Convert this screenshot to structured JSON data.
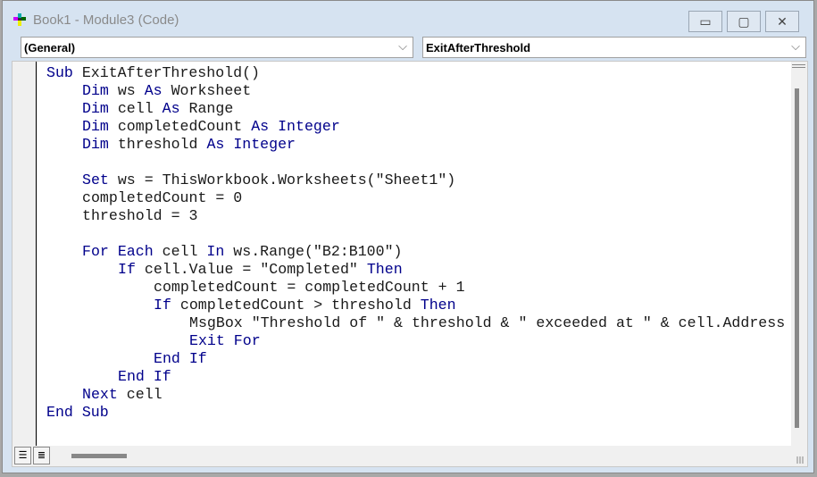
{
  "window": {
    "title": "Book1 - Module3 (Code)",
    "minimize": "▭",
    "restore": "▢",
    "close": "✕"
  },
  "combos": {
    "object": "(General)",
    "procedure": "ExitAfterThreshold",
    "chevron": "⌵"
  },
  "code": [
    {
      "indent": 0,
      "tokens": [
        {
          "t": "Sub ",
          "k": 1
        },
        {
          "t": "ExitAfterThreshold()",
          "k": 0
        }
      ]
    },
    {
      "indent": 1,
      "tokens": [
        {
          "t": "Dim ",
          "k": 1
        },
        {
          "t": "ws ",
          "k": 0
        },
        {
          "t": "As ",
          "k": 1
        },
        {
          "t": "Worksheet",
          "k": 0
        }
      ]
    },
    {
      "indent": 1,
      "tokens": [
        {
          "t": "Dim ",
          "k": 1
        },
        {
          "t": "cell ",
          "k": 0
        },
        {
          "t": "As ",
          "k": 1
        },
        {
          "t": "Range",
          "k": 0
        }
      ]
    },
    {
      "indent": 1,
      "tokens": [
        {
          "t": "Dim ",
          "k": 1
        },
        {
          "t": "completedCount ",
          "k": 0
        },
        {
          "t": "As ",
          "k": 1
        },
        {
          "t": "Integer",
          "k": 1
        }
      ]
    },
    {
      "indent": 1,
      "tokens": [
        {
          "t": "Dim ",
          "k": 1
        },
        {
          "t": "threshold ",
          "k": 0
        },
        {
          "t": "As ",
          "k": 1
        },
        {
          "t": "Integer",
          "k": 1
        }
      ]
    },
    {
      "indent": 0,
      "tokens": []
    },
    {
      "indent": 1,
      "tokens": [
        {
          "t": "Set ",
          "k": 1
        },
        {
          "t": "ws = ThisWorkbook.Worksheets(\"Sheet1\")",
          "k": 0
        }
      ]
    },
    {
      "indent": 1,
      "tokens": [
        {
          "t": "completedCount = 0",
          "k": 0
        }
      ]
    },
    {
      "indent": 1,
      "tokens": [
        {
          "t": "threshold = 3",
          "k": 0
        }
      ]
    },
    {
      "indent": 0,
      "tokens": []
    },
    {
      "indent": 1,
      "tokens": [
        {
          "t": "For Each ",
          "k": 1
        },
        {
          "t": "cell ",
          "k": 0
        },
        {
          "t": "In ",
          "k": 1
        },
        {
          "t": "ws.Range(\"B2:B100\")",
          "k": 0
        }
      ]
    },
    {
      "indent": 2,
      "tokens": [
        {
          "t": "If ",
          "k": 1
        },
        {
          "t": "cell.Value = \"Completed\" ",
          "k": 0
        },
        {
          "t": "Then",
          "k": 1
        }
      ]
    },
    {
      "indent": 3,
      "tokens": [
        {
          "t": "completedCount = completedCount + 1",
          "k": 0
        }
      ]
    },
    {
      "indent": 3,
      "tokens": [
        {
          "t": "If ",
          "k": 1
        },
        {
          "t": "completedCount > threshold ",
          "k": 0
        },
        {
          "t": "Then",
          "k": 1
        }
      ]
    },
    {
      "indent": 4,
      "tokens": [
        {
          "t": "MsgBox \"Threshold of \" & threshold & \" exceeded at \" & cell.Address",
          "k": 0
        }
      ]
    },
    {
      "indent": 4,
      "tokens": [
        {
          "t": "Exit For",
          "k": 1
        }
      ]
    },
    {
      "indent": 3,
      "tokens": [
        {
          "t": "End If",
          "k": 1
        }
      ]
    },
    {
      "indent": 2,
      "tokens": [
        {
          "t": "End If",
          "k": 1
        }
      ]
    },
    {
      "indent": 1,
      "tokens": [
        {
          "t": "Next ",
          "k": 1
        },
        {
          "t": "cell",
          "k": 0
        }
      ]
    },
    {
      "indent": 0,
      "tokens": [
        {
          "t": "End Sub",
          "k": 1
        }
      ]
    }
  ],
  "view_buttons": {
    "procedure_view": "☰",
    "module_view": "≣"
  }
}
